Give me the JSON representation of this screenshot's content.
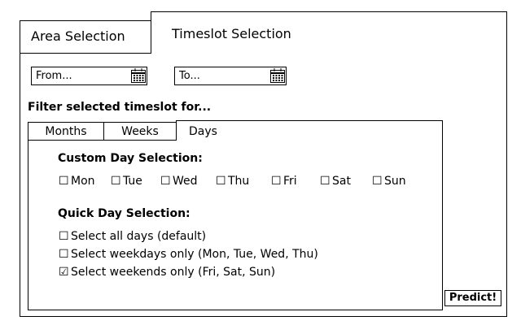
{
  "tabs": {
    "area_label": "Area Selection",
    "timeslot_label": "Timeslot Selection"
  },
  "date_range": {
    "from_placeholder": "From...",
    "to_placeholder": "To...",
    "calendar_icon": "calendar-icon"
  },
  "filter": {
    "title": "Filter selected timeslot for...",
    "subtabs": [
      {
        "label": "Months",
        "active": false
      },
      {
        "label": "Weeks",
        "active": false
      },
      {
        "label": "Days",
        "active": true
      }
    ]
  },
  "custom_days": {
    "title": "Custom Day Selection:",
    "days": [
      {
        "label": "Mon",
        "checked": false
      },
      {
        "label": "Tue",
        "checked": false
      },
      {
        "label": "Wed",
        "checked": false
      },
      {
        "label": "Thu",
        "checked": false
      },
      {
        "label": "Fri",
        "checked": false
      },
      {
        "label": "Sat",
        "checked": false
      },
      {
        "label": "Sun",
        "checked": false
      }
    ]
  },
  "quick_days": {
    "title": "Quick Day Selection:",
    "options": [
      {
        "label": "Select all days (default)",
        "checked": false
      },
      {
        "label": "Select weekdays only (Mon, Tue, Wed, Thu)",
        "checked": false
      },
      {
        "label": "Select weekends only (Fri, Sat, Sun)",
        "checked": true
      }
    ]
  },
  "glyphs": {
    "unchecked": "☐",
    "checked": "☑"
  },
  "predict_label": "Predict!"
}
